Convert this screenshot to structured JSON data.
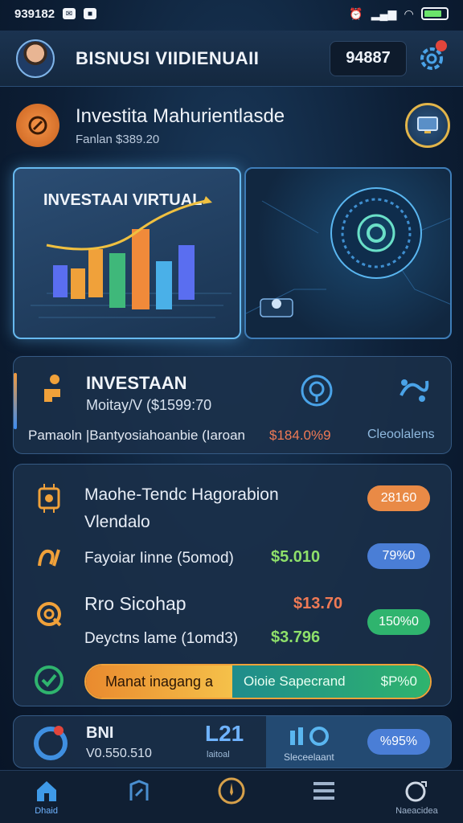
{
  "status_bar": {
    "time": "939182",
    "battery_level": 0.8
  },
  "header": {
    "title": "BISNUSI VIIDIENUAII",
    "balance": "94887"
  },
  "promo": {
    "title": "Investita Mahurientlasde",
    "subtitle": "Fanlan $389.20"
  },
  "hero": {
    "title": "INVESTAAI VIRTUAL"
  },
  "investment_card": {
    "title": "INVESTAAN",
    "subtitle": "Moitay/V ($1599:70",
    "footer": "Pamaoln |Bantyosiahoanbie (Iaroan",
    "percent": "$184.0%9",
    "cloud_label": "Cleoolalens"
  },
  "list": {
    "rows": [
      {
        "title": "Maohe-Tendc Hagorabion",
        "subtitle": "Vlendalo",
        "pill": "28160"
      },
      {
        "title": "Fayoiar Iinne (5omod)",
        "value": "$5.010",
        "pill": "79%0"
      },
      {
        "title": "Rro Sicohap",
        "value": "$13.70",
        "pill": ""
      },
      {
        "title": "Deyctns lame (1omd3)",
        "value": "$3.796",
        "pill": "150%0"
      }
    ],
    "promo_bar": {
      "left": "Manat inagang a",
      "right": "Oioie Sapecrand",
      "pct": "$P%0"
    }
  },
  "bottom_card": {
    "title": "BNI",
    "subtitle": "V0.550.510",
    "number": "L21",
    "number_label": "laitoal",
    "right_label": "Sleceelaant",
    "pill": "%95%"
  },
  "bottom_nav": {
    "items": [
      {
        "label": "Dhaid",
        "icon": "home-icon"
      },
      {
        "label": "",
        "icon": "share-icon"
      },
      {
        "label": "",
        "icon": "compass-icon"
      },
      {
        "label": "",
        "icon": "menu-icon"
      },
      {
        "label": "Naeacidea",
        "icon": "profile-icon"
      }
    ]
  },
  "colors": {
    "accent_orange": "#e98a46",
    "accent_blue": "#4a7ed6",
    "accent_green": "#2fb46e",
    "value_green": "#8ee06a",
    "value_red": "#f07a55",
    "background": "#0d1f36"
  }
}
